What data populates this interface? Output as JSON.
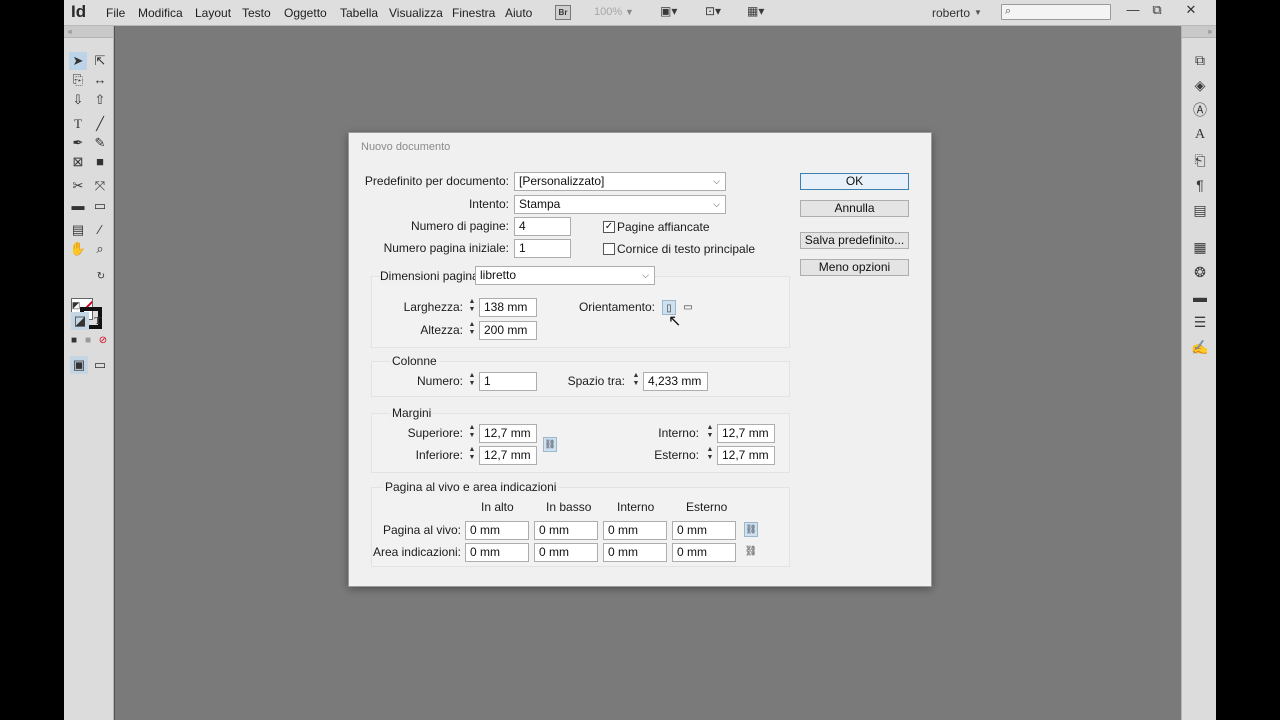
{
  "app": {
    "logo": "Id",
    "menu": [
      "File",
      "Modifica",
      "Layout",
      "Testo",
      "Oggetto",
      "Tabella",
      "Visualizza",
      "Finestra",
      "Aiuto"
    ],
    "bridge_badge": "Br",
    "zoom": "100%",
    "user": "roberto",
    "search_icon": "search-icon",
    "window_controls": [
      "—",
      "⧉",
      "✕"
    ]
  },
  "dialog": {
    "title": "Nuovo documento",
    "preset_label": "Predefinito per documento:",
    "preset_value": "[Personalizzato]",
    "intent_label": "Intento:",
    "intent_value": "Stampa",
    "pages_label": "Numero di pagine:",
    "pages_value": "4",
    "facing_label": "Pagine affiancate",
    "facing_checked": true,
    "start_page_label": "Numero pagina iniziale:",
    "start_page_value": "1",
    "primary_frame_label": "Cornice di testo principale",
    "primary_frame_checked": false,
    "page_size_label": "Dimensioni pagina:",
    "page_size_value": "libretto",
    "width_label": "Larghezza:",
    "width_value": "138 mm",
    "height_label": "Altezza:",
    "height_value": "200 mm",
    "orientation_label": "Orientamento:",
    "columns": {
      "title": "Colonne",
      "number_label": "Numero:",
      "number_value": "1",
      "gutter_label": "Spazio tra:",
      "gutter_value": "4,233 mm"
    },
    "margins": {
      "title": "Margini",
      "top_label": "Superiore:",
      "top_value": "12,7 mm",
      "bottom_label": "Inferiore:",
      "bottom_value": "12,7 mm",
      "inside_label": "Interno:",
      "inside_value": "12,7 mm",
      "outside_label": "Esterno:",
      "outside_value": "12,7 mm"
    },
    "bleed": {
      "title": "Pagina al vivo e area indicazioni",
      "headers": [
        "In alto",
        "In basso",
        "Interno",
        "Esterno"
      ],
      "bleed_label": "Pagina al vivo:",
      "bleed_values": [
        "0 mm",
        "0 mm",
        "0 mm",
        "0 mm"
      ],
      "slug_label": "Area indicazioni:",
      "slug_values": [
        "0 mm",
        "0 mm",
        "0 mm",
        "0 mm"
      ]
    },
    "buttons": {
      "ok": "OK",
      "cancel": "Annulla",
      "save_preset": "Salva predefinito...",
      "fewer_options": "Meno opzioni"
    }
  }
}
